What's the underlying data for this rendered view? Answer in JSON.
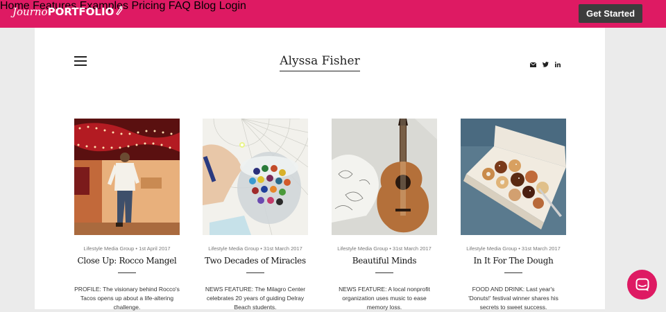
{
  "brand": {
    "logo_script": "Journo",
    "logo_bold": "PORTFOLIO"
  },
  "nav": {
    "items": [
      {
        "label": "Home"
      },
      {
        "label": "Features"
      },
      {
        "label": "Examples"
      },
      {
        "label": "Pricing"
      },
      {
        "label": "FAQ"
      },
      {
        "label": "Blog"
      },
      {
        "label": "Login"
      }
    ],
    "cta": "Get Started"
  },
  "site": {
    "title": "Alyssa Fisher",
    "social_icons": [
      "mail-icon",
      "twitter-icon",
      "linkedin-icon"
    ]
  },
  "posts": [
    {
      "meta": "Lifestyle Media Group • 1st April 2017",
      "title": "Close Up: Rocco Mangel",
      "excerpt": "PROFILE: The visionary behind Rocco's Tacos opens up about a life-altering challenge."
    },
    {
      "meta": "Lifestyle Media Group • 31st March 2017",
      "title": "Two Decades of Miracles",
      "excerpt": "NEWS FEATURE: The Milagro Center celebrates 20 years of guiding Delray Beach students."
    },
    {
      "meta": "Lifestyle Media Group • 31st March 2017",
      "title": "Beautiful Minds",
      "excerpt": "NEWS FEATURE: A local nonprofit organization uses music to ease memory loss."
    },
    {
      "meta": "Lifestyle Media Group • 31st March 2017",
      "title": "In It For The Dough",
      "excerpt": "FOOD AND DRINK: Last year's 'Donuts!' festival winner shares his secrets to sweet success."
    }
  ],
  "colors": {
    "brand": "#de1a63",
    "cta_bg": "#3d3d3d"
  },
  "chat_icon": "chat-bubble-icon"
}
